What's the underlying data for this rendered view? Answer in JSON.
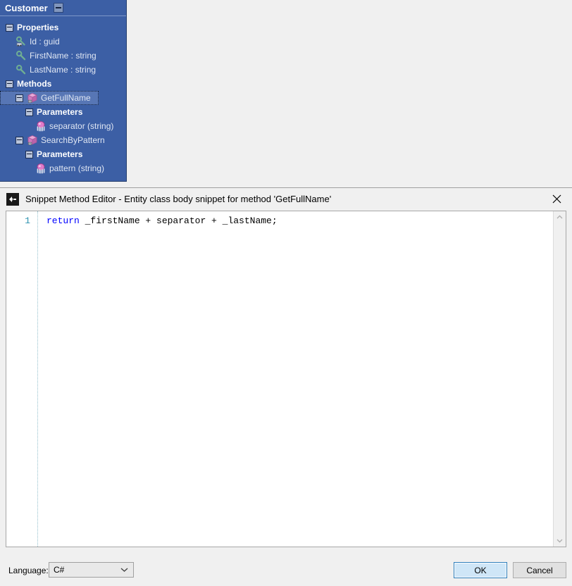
{
  "designer": {
    "entity_name": "Customer",
    "collapse_icon": "minus-box-icon",
    "tree": [
      {
        "label": "Properties",
        "level": 0,
        "bold": true,
        "expander": true,
        "icon": null,
        "selected": false
      },
      {
        "label": "Id : guid",
        "level": 1,
        "bold": false,
        "expander": false,
        "icon": "key-property-icon",
        "selected": false
      },
      {
        "label": "FirstName : string",
        "level": 1,
        "bold": false,
        "expander": false,
        "icon": "property-icon",
        "selected": false
      },
      {
        "label": "LastName : string",
        "level": 1,
        "bold": false,
        "expander": false,
        "icon": "property-icon",
        "selected": false
      },
      {
        "label": "Methods",
        "level": 0,
        "bold": true,
        "expander": true,
        "icon": null,
        "selected": false
      },
      {
        "label": "GetFullName",
        "level": 1,
        "bold": false,
        "expander": true,
        "icon": "method-icon",
        "selected": true
      },
      {
        "label": "Parameters",
        "level": 2,
        "bold": true,
        "expander": true,
        "icon": null,
        "selected": false
      },
      {
        "label": "separator (string)",
        "level": 3,
        "bold": false,
        "expander": false,
        "icon": "parameter-icon",
        "selected": false
      },
      {
        "label": "SearchByPattern",
        "level": 1,
        "bold": false,
        "expander": true,
        "icon": "method-icon",
        "selected": false
      },
      {
        "label": "Parameters",
        "level": 2,
        "bold": true,
        "expander": true,
        "icon": null,
        "selected": false
      },
      {
        "label": "pattern (string)",
        "level": 3,
        "bold": false,
        "expander": false,
        "icon": "parameter-icon",
        "selected": false
      }
    ],
    "colors": {
      "panel_background": "#3c5fa5",
      "selected_node": "#5776b5",
      "header_text": "#ffffff",
      "node_text": "#dfe6f3"
    }
  },
  "dialog": {
    "app_icon": "snippet-editor-icon",
    "title": "Snippet Method Editor - Entity class body snippet for method 'GetFullName'",
    "close_icon": "close-icon",
    "editor": {
      "lines": [
        {
          "number": "1",
          "keyword": "return",
          "rest": " _firstName + separator + _lastName;"
        }
      ],
      "scroll_up_icon": "chevron-up-icon",
      "scroll_down_icon": "chevron-down-icon",
      "keyword_color": "#0000ff",
      "line_number_color": "#2b91af"
    },
    "footer": {
      "language_label": "Language:",
      "language_value": "C#",
      "language_dropdown_icon": "chevron-down-icon",
      "ok_label": "OK",
      "cancel_label": "Cancel",
      "ok_accent_color": "#2b7dbb"
    }
  }
}
